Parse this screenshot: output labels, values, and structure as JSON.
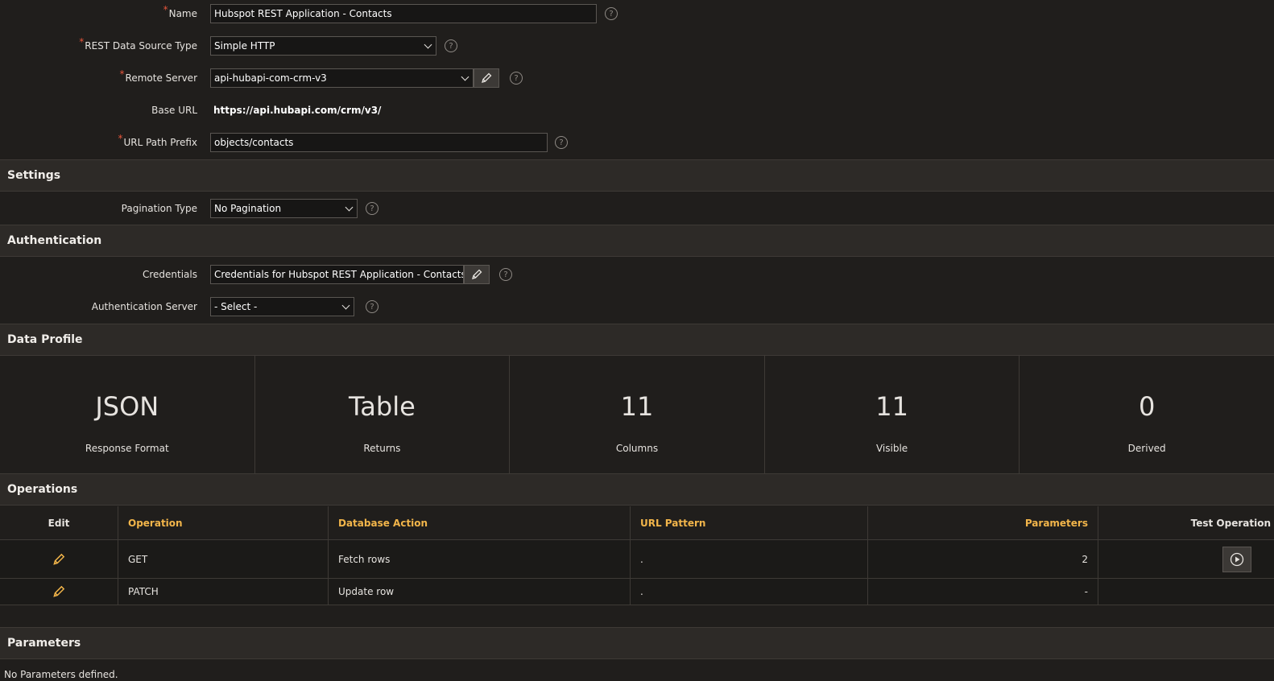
{
  "form": {
    "name": {
      "label": "Name",
      "value": "Hubspot REST Application - Contacts",
      "required": true
    },
    "source_type": {
      "label": "REST Data Source Type",
      "value": "Simple HTTP",
      "required": true
    },
    "remote_server": {
      "label": "Remote Server",
      "value": "api-hubapi-com-crm-v3",
      "required": true
    },
    "base_url": {
      "label": "Base URL",
      "value": "https://api.hubapi.com/crm/v3/"
    },
    "path_prefix": {
      "label": "URL Path Prefix",
      "value": "objects/contacts",
      "required": true
    },
    "required_marker": "*",
    "help_glyph": "?"
  },
  "settings": {
    "title": "Settings",
    "pagination": {
      "label": "Pagination Type",
      "value": "No Pagination"
    }
  },
  "authentication": {
    "title": "Authentication",
    "credentials": {
      "label": "Credentials",
      "value": "Credentials for Hubspot REST Application - Contacts"
    },
    "auth_server": {
      "label": "Authentication Server",
      "value": "- Select -"
    }
  },
  "data_profile": {
    "title": "Data Profile",
    "tiles": [
      {
        "value": "JSON",
        "label": "Response Format"
      },
      {
        "value": "Table",
        "label": "Returns"
      },
      {
        "value": "11",
        "label": "Columns"
      },
      {
        "value": "11",
        "label": "Visible"
      },
      {
        "value": "0",
        "label": "Derived"
      }
    ]
  },
  "operations": {
    "title": "Operations",
    "columns": [
      "Edit",
      "Operation",
      "Database Action",
      "URL Pattern",
      "Parameters",
      "Test Operation"
    ],
    "rows": [
      {
        "operation": "GET",
        "db_action": "Fetch rows",
        "url_pattern": ".",
        "parameters": "2",
        "testable": true
      },
      {
        "operation": "PATCH",
        "db_action": "Update row",
        "url_pattern": ".",
        "parameters": "-",
        "testable": false
      }
    ]
  },
  "parameters": {
    "title": "Parameters",
    "empty_text": "No Parameters defined."
  },
  "icons": {
    "edit": "pencil-icon",
    "help": "help-circle-icon",
    "dropdown": "chevron-down-icon",
    "test": "play-icon"
  },
  "colors": {
    "background": "#201e1c",
    "section": "#2d2a27",
    "accent_header": "#f2b54a",
    "required": "#e5553b",
    "pencil": "#f2b54a"
  }
}
